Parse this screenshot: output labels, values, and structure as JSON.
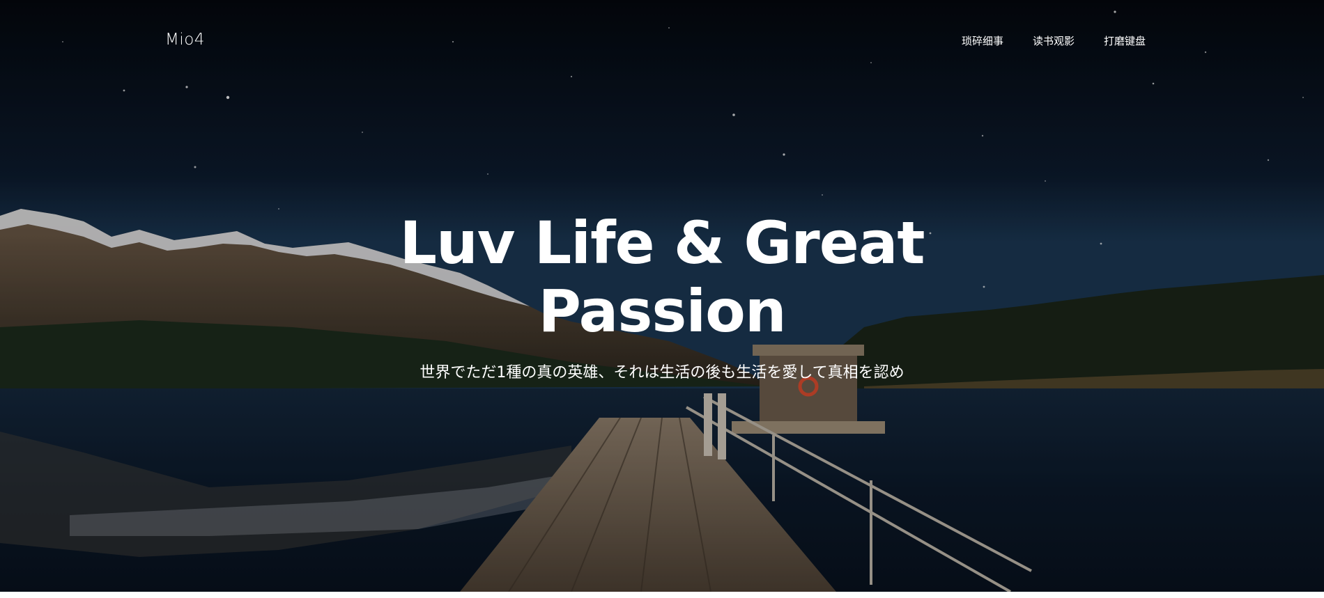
{
  "nav": {
    "brand": "Mio4",
    "links": [
      {
        "label": "琐碎细事"
      },
      {
        "label": "读书观影"
      },
      {
        "label": "打磨键盘"
      }
    ]
  },
  "hero": {
    "headline_line1": "Luv Life & Great",
    "headline_line2": "Passion",
    "subtitle": "世界でただ1種の真の英雄、それは生活の後も生活を愛して真相を認め"
  },
  "colors": {
    "text": "#ffffff",
    "sky_top": "#05080f",
    "sky_horizon": "#10243a",
    "water": "#0b1828",
    "mountain": "#5a4a3a",
    "snow": "#e8ecf0",
    "forest": "#1a2418",
    "pier": "#6b5a48"
  }
}
